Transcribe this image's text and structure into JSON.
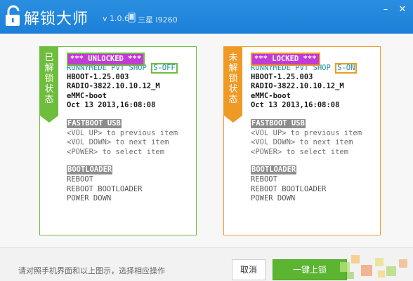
{
  "app": {
    "title": "解锁大师",
    "version": "v 1.0.6",
    "device": "三星 I9260"
  },
  "window_controls": {
    "minimize": "–",
    "close": "✕"
  },
  "panels": [
    {
      "id": "unlocked",
      "side_label": "已解锁状态",
      "status": "*** UNLOCKED ***",
      "line1": "RUNNYMEDE PVT SHOP",
      "flag": "S-OFF",
      "line2": "HBOOT-1.25.003",
      "line3": "RADIO-3822.10.10.12_M",
      "line4": "eMMC-boot",
      "line5": "Oct 13 2013,16:08:08",
      "fastboot_header": "FASTBOOT USB",
      "fastboot_lines": [
        "<VOL UP> to previous item",
        "<VOL DOWN> to next item",
        "<POWER> to select item"
      ],
      "bootloader_header": "BOOTLOADER",
      "bootloader_lines": [
        "REBOOT",
        "REBOOT BOOTLOADER",
        "POWER DOWN"
      ]
    },
    {
      "id": "locked",
      "side_label": "未解锁状态",
      "status": "*** LOCKED ***",
      "line1": "RUNNYMEDE PVT SHOP",
      "flag": "S-ON",
      "line2": "HBOOT-1.25.003",
      "line3": "RADIO-3822.10.10.12_M",
      "line4": "eMMC-boot",
      "line5": "Oct 13 2013,16:08:08",
      "fastboot_header": "FASTBOOT USB",
      "fastboot_lines": [
        "<VOL UP> to previous item",
        "<VOL DOWN> to next item",
        "<POWER> to select item"
      ],
      "bootloader_header": "BOOTLOADER",
      "bootloader_lines": [
        "REBOOT",
        "REBOOT BOOTLOADER",
        "POWER DOWN"
      ]
    }
  ],
  "footer": {
    "hint": "请对照手机界面和以上图示，选择相应操作",
    "cancel_label": "取消",
    "lock_label": "一键上锁"
  },
  "colors": {
    "titlebar": "#1c7fd8",
    "unlocked_accent": "#6ebd3c",
    "locked_accent": "#ef9a24",
    "status_label": "#c33bd6",
    "lock_button": "#5cb531"
  }
}
